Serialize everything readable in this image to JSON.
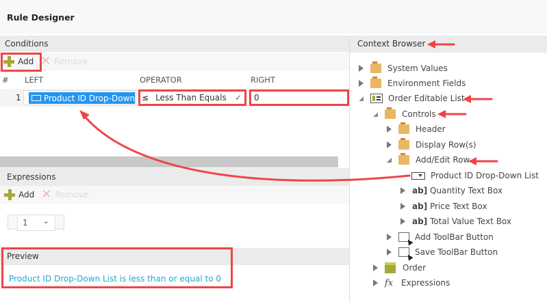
{
  "title": "Rule Designer",
  "conditions": {
    "header": "Conditions",
    "add_label": "Add",
    "remove_label": "Remove",
    "columns": [
      "#",
      "LEFT",
      "OPERATOR",
      "RIGHT"
    ],
    "rows": [
      {
        "num": "1",
        "left": "Product ID Drop-Down",
        "operator": "Less Than Equals",
        "right": "0"
      }
    ]
  },
  "expressions": {
    "header": "Expressions",
    "add_label": "Add",
    "remove_label": "Remove",
    "page_value": "1"
  },
  "preview": {
    "header": "Preview",
    "text": "Product ID Drop-Down List is less than or equal to 0"
  },
  "context_browser": {
    "header": "Context Browser",
    "items": [
      {
        "label": "System Values",
        "icon": "folder-icon"
      },
      {
        "label": "Environment Fields",
        "icon": "folder-icon"
      },
      {
        "label": "Order Editable List",
        "icon": "list-icon"
      },
      {
        "label": "Controls",
        "icon": "folder-icon"
      },
      {
        "label": "Header",
        "icon": "folder-icon"
      },
      {
        "label": "Display Row(s)",
        "icon": "folder-icon"
      },
      {
        "label": "Add/Edit Row",
        "icon": "folder-icon"
      },
      {
        "label": "Product ID Drop-Down List",
        "icon": "dropdown-icon"
      },
      {
        "label": "Quantity Text Box",
        "icon": "textbox-icon"
      },
      {
        "label": "Price Text Box",
        "icon": "textbox-icon"
      },
      {
        "label": "Total Value Text Box",
        "icon": "textbox-icon"
      },
      {
        "label": "Add ToolBar Button",
        "icon": "button-icon"
      },
      {
        "label": "Save ToolBar Button",
        "icon": "button-icon"
      },
      {
        "label": "Order",
        "icon": "smartobject-icon"
      },
      {
        "label": "Expressions",
        "icon": "fx-icon"
      }
    ]
  },
  "colors": {
    "accent": "#2196f3",
    "annotation": "#f04347",
    "preview_text": "#26a9c9"
  }
}
